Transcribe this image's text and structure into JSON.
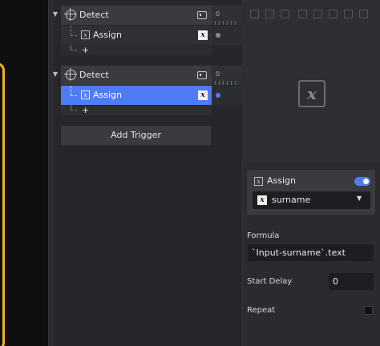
{
  "triggers": [
    {
      "label": "Detect",
      "action": {
        "label": "Assign",
        "icon": "x-variable-icon",
        "selected": false
      },
      "add_label": "+"
    },
    {
      "label": "Detect",
      "action": {
        "label": "Assign",
        "icon": "x-variable-icon",
        "selected": true
      },
      "add_label": "+"
    }
  ],
  "add_trigger_label": "Add Trigger",
  "timeline": {
    "tick_start": "0"
  },
  "preview": {
    "icon": "x-variable-icon",
    "glyph": "x"
  },
  "action_panel": {
    "title": "Assign",
    "enabled": true,
    "variable": "surname",
    "formula_label": "Formula",
    "formula_value": "`Input-surname`.text",
    "start_delay_label": "Start Delay",
    "start_delay_value": "0",
    "repeat_label": "Repeat",
    "repeat_checked": false
  },
  "colors": {
    "accent": "#4f7cf5",
    "artboard": "#f2b418"
  },
  "icon_glyph": "x"
}
